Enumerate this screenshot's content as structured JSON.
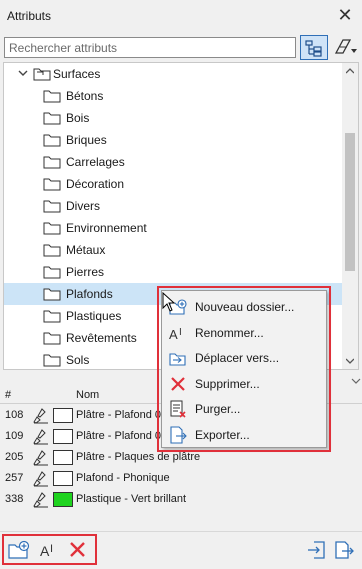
{
  "window": {
    "title": "Attributs"
  },
  "search": {
    "placeholder": "Rechercher attributs"
  },
  "tree": {
    "root_label": "Surfaces",
    "items": [
      {
        "label": "Bétons"
      },
      {
        "label": "Bois"
      },
      {
        "label": "Briques"
      },
      {
        "label": "Carrelages"
      },
      {
        "label": "Décoration"
      },
      {
        "label": "Divers"
      },
      {
        "label": "Environnement"
      },
      {
        "label": "Métaux"
      },
      {
        "label": "Pierres"
      },
      {
        "label": "Plafonds",
        "selected": true
      },
      {
        "label": "Plastiques"
      },
      {
        "label": "Revêtements"
      },
      {
        "label": "Sols"
      }
    ]
  },
  "table": {
    "headers": {
      "number": "#",
      "name": "Nom"
    },
    "rows": [
      {
        "number": "108",
        "name": "Plâtre - Plafond 0",
        "swatch": "#ffffff"
      },
      {
        "number": "109",
        "name": "Plâtre - Plafond 0",
        "swatch": "#ffffff"
      },
      {
        "number": "205",
        "name": "Plâtre - Plaques de plâtre",
        "swatch": "#ffffff"
      },
      {
        "number": "257",
        "name": "Plafond - Phonique",
        "swatch": "#ffffff"
      },
      {
        "number": "338",
        "name": "Plastique - Vert brillant",
        "swatch": "#1fd31f"
      }
    ]
  },
  "context_menu": {
    "items": [
      {
        "label": "Nouveau dossier...",
        "icon": "new-folder-icon"
      },
      {
        "label": "Renommer...",
        "icon": "rename-icon"
      },
      {
        "label": "Déplacer vers...",
        "icon": "move-to-icon"
      },
      {
        "label": "Supprimer...",
        "icon": "delete-icon"
      },
      {
        "label": "Purger...",
        "icon": "purge-icon"
      },
      {
        "label": "Exporter...",
        "icon": "export-icon"
      }
    ]
  },
  "bottom_toolbar": {
    "left": [
      "new-folder-icon",
      "rename-icon",
      "delete-icon"
    ],
    "right": [
      "import-icon",
      "export-icon"
    ]
  },
  "colors": {
    "selection": "#cce4f7",
    "highlight_box": "#e0303a",
    "delete_red": "#e0303a",
    "accent_blue": "#2f6fb7"
  }
}
